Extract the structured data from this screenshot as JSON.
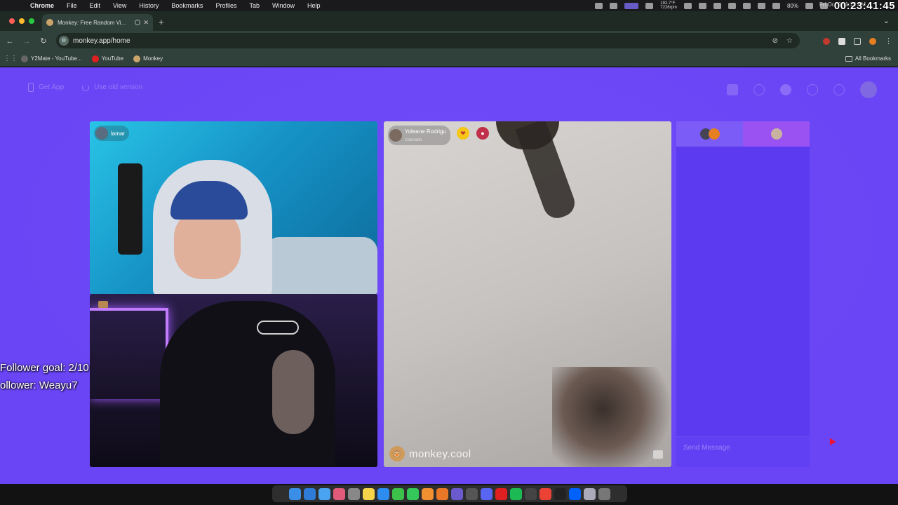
{
  "menubar": {
    "app": "Chrome",
    "items": [
      "File",
      "Edit",
      "View",
      "History",
      "Bookmarks",
      "Profiles",
      "Tab",
      "Window",
      "Help"
    ],
    "network": {
      "up": "192.7°F",
      "down": "7226rpm"
    },
    "battery": "80%",
    "datetime": "Fri Oct 3  11:15 AM"
  },
  "timer": "00:23:41:45",
  "browser": {
    "tab_title": "Monkey: Free Random Vi...",
    "url": "monkey.app/home",
    "bookmarks": [
      "Y2Mate - YouTube...",
      "YouTube",
      "Monkey"
    ],
    "all_bookmarks": "All Bookmarks"
  },
  "page": {
    "nav_left": [
      "Get App",
      "Use old version"
    ],
    "me": {
      "name": "lamar"
    },
    "stranger": {
      "name": "Yoleane Rodrigu",
      "location": "Colorado"
    },
    "watermark": "monkey.cool",
    "chat_placeholder": "Send Message"
  },
  "overlay": {
    "goal": "Follower goal: 2/10",
    "latest": "ollower: Weayu7"
  },
  "colors": {
    "page_bg": "#6a45f5",
    "chat_panel": "#5b3af0",
    "accent_pink": "#9b52f3"
  },
  "dock_apps": [
    "finder",
    "safari",
    "mail",
    "photos",
    "calculator",
    "notes",
    "appstore",
    "messages",
    "facetime",
    "garageband",
    "instruments",
    "imovie",
    "live",
    "discord",
    "youtube",
    "spotify",
    "obs",
    "chrome",
    "capcut",
    "dropbox",
    "preview",
    "trash"
  ]
}
